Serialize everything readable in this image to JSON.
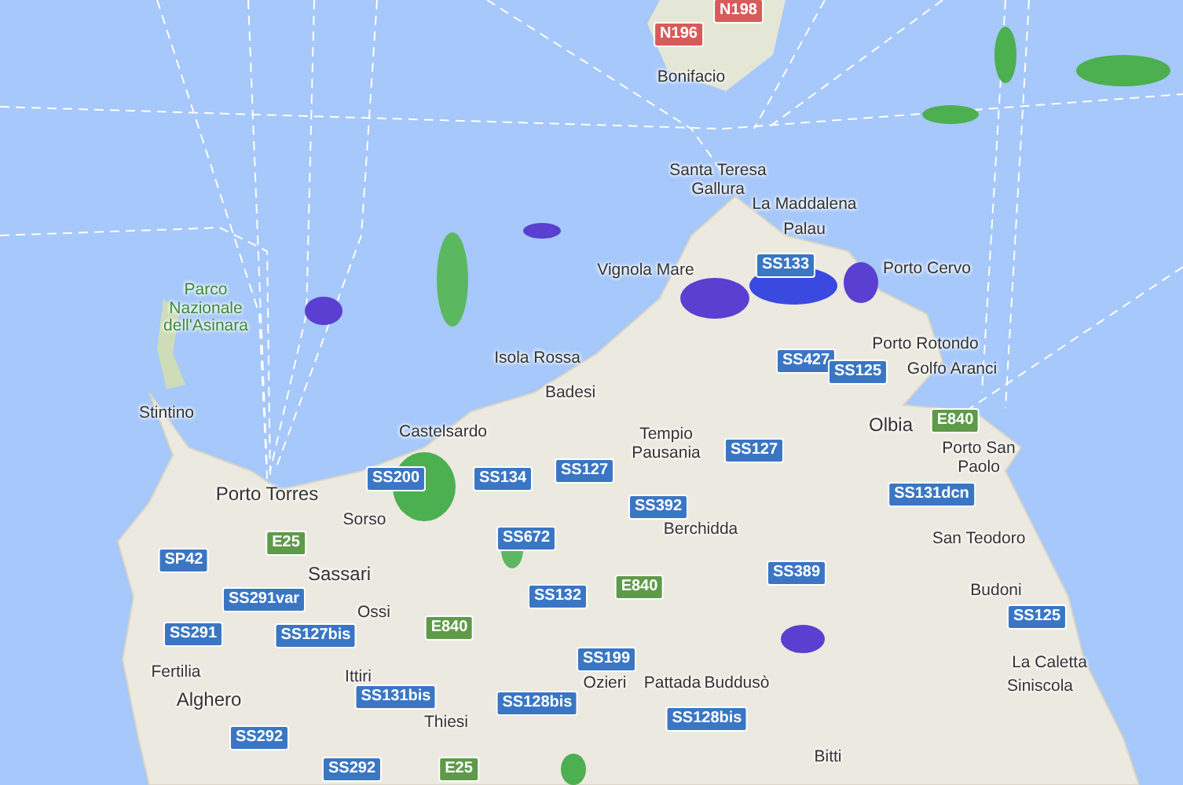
{
  "map": {
    "places": [
      {
        "name": "Bonifacio",
        "kind": "town"
      },
      {
        "name": "Santa Teresa Gallura",
        "kind": "town"
      },
      {
        "name": "La Maddalena",
        "kind": "town"
      },
      {
        "name": "Palau",
        "kind": "town"
      },
      {
        "name": "Vignola Mare",
        "kind": "town"
      },
      {
        "name": "Porto Cervo",
        "kind": "town"
      },
      {
        "name": "Parco Nazionale dell'Asinara",
        "kind": "park"
      },
      {
        "name": "Isola Rossa",
        "kind": "town"
      },
      {
        "name": "Porto Rotondo",
        "kind": "town"
      },
      {
        "name": "Golfo Aranci",
        "kind": "town"
      },
      {
        "name": "Badesi",
        "kind": "town"
      },
      {
        "name": "Stintino",
        "kind": "town"
      },
      {
        "name": "Castelsardo",
        "kind": "town"
      },
      {
        "name": "Tempio Pausania",
        "kind": "town"
      },
      {
        "name": "Olbia",
        "kind": "city"
      },
      {
        "name": "Porto San Paolo",
        "kind": "town"
      },
      {
        "name": "Porto Torres",
        "kind": "city"
      },
      {
        "name": "Sorso",
        "kind": "town"
      },
      {
        "name": "Berchidda",
        "kind": "town"
      },
      {
        "name": "San Teodoro",
        "kind": "town"
      },
      {
        "name": "Sassari",
        "kind": "city"
      },
      {
        "name": "Budoni",
        "kind": "town"
      },
      {
        "name": "Ossi",
        "kind": "town"
      },
      {
        "name": "La Caletta",
        "kind": "town"
      },
      {
        "name": "Fertilia",
        "kind": "town"
      },
      {
        "name": "Ittiri",
        "kind": "town"
      },
      {
        "name": "Ozieri",
        "kind": "town"
      },
      {
        "name": "Pattada",
        "kind": "town"
      },
      {
        "name": "Buddusò",
        "kind": "town"
      },
      {
        "name": "Siniscola",
        "kind": "town"
      },
      {
        "name": "Alghero",
        "kind": "city"
      },
      {
        "name": "Thiesi",
        "kind": "town"
      },
      {
        "name": "Bitti",
        "kind": "town"
      }
    ],
    "roads": [
      {
        "label": "N198",
        "kind": "national"
      },
      {
        "label": "N196",
        "kind": "national"
      },
      {
        "label": "SS133",
        "kind": "state"
      },
      {
        "label": "SS427",
        "kind": "state"
      },
      {
        "label": "SS125",
        "kind": "state"
      },
      {
        "label": "E840",
        "kind": "european"
      },
      {
        "label": "SS200",
        "kind": "state"
      },
      {
        "label": "SS134",
        "kind": "state"
      },
      {
        "label": "SS127",
        "kind": "state"
      },
      {
        "label": "SS127",
        "kind": "state"
      },
      {
        "label": "SS392",
        "kind": "state"
      },
      {
        "label": "SS131dcn",
        "kind": "state"
      },
      {
        "label": "SS672",
        "kind": "state"
      },
      {
        "label": "E25",
        "kind": "european"
      },
      {
        "label": "SP42",
        "kind": "state"
      },
      {
        "label": "SS389",
        "kind": "state"
      },
      {
        "label": "SS132",
        "kind": "state"
      },
      {
        "label": "E840",
        "kind": "european"
      },
      {
        "label": "SS291var",
        "kind": "state"
      },
      {
        "label": "SS125",
        "kind": "state"
      },
      {
        "label": "SS291",
        "kind": "state"
      },
      {
        "label": "SS127bis",
        "kind": "state"
      },
      {
        "label": "E840",
        "kind": "european"
      },
      {
        "label": "SS199",
        "kind": "state"
      },
      {
        "label": "SS131bis",
        "kind": "state"
      },
      {
        "label": "SS128bis",
        "kind": "state"
      },
      {
        "label": "SS128bis",
        "kind": "state"
      },
      {
        "label": "SS292",
        "kind": "state"
      },
      {
        "label": "SS292",
        "kind": "state"
      },
      {
        "label": "E25",
        "kind": "european"
      }
    ]
  }
}
